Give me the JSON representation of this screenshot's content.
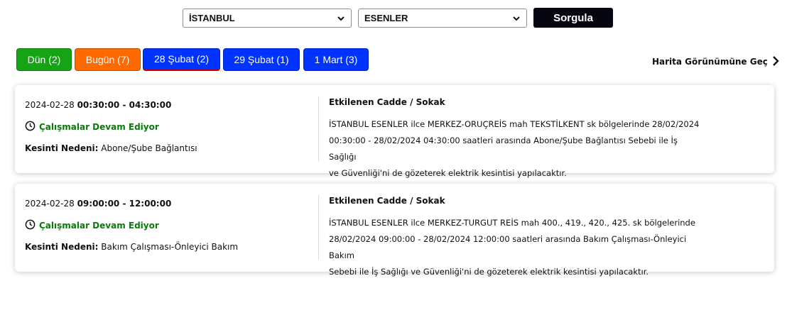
{
  "filters": {
    "city": "İSTANBUL",
    "district": "ESENLER",
    "query_label": "Sorgula"
  },
  "tabs": [
    {
      "label": "Dün (2)",
      "color": "#16a316"
    },
    {
      "label": "Bugün (7)",
      "color": "#ff6a00"
    },
    {
      "label": "28 Şubat (2)",
      "color": "#0033ff",
      "active": true
    },
    {
      "label": "29 Şubat (1)",
      "color": "#0033ff"
    },
    {
      "label": "1 Mart (3)",
      "color": "#0033ff"
    }
  ],
  "map_link": "Harita Görünümüne Geç",
  "outages": [
    {
      "date": "2024-02-28",
      "time_range": "00:30:00 - 04:30:00",
      "status": "Çalışmalar Devam Ediyor",
      "reason_label": "Kesinti Nedeni:",
      "reason": "Abone/Şube Bağlantısı",
      "affected_title": "Etkilenen Cadde / Sokak",
      "affected_lines": [
        "İSTANBUL ESENLER ilce MERKEZ-ORUÇREİS mah TEKSTİLKENT sk bölgelerinde 28/02/2024",
        "00:30:00 - 28/02/2024 04:30:00 saatleri arasında Abone/Şube Bağlantısı Sebebi ile İş Sağlığı",
        "ve Güvenliği'ni de gözeterek elektrik kesintisi yapılacaktır."
      ]
    },
    {
      "date": "2024-02-28",
      "time_range": "09:00:00 - 12:00:00",
      "status": "Çalışmalar Devam Ediyor",
      "reason_label": "Kesinti Nedeni:",
      "reason": "Bakım Çalışması-Önleyici Bakım",
      "affected_title": "Etkilenen Cadde / Sokak",
      "affected_lines": [
        "İSTANBUL ESENLER ilce MERKEZ-TURGUT REİS mah 400., 419., 420., 425. sk bölgelerinde",
        "28/02/2024 09:00:00 - 28/02/2024 12:00:00 saatleri arasında Bakım Çalışması-Önleyici Bakım",
        "Sebebi ile İş Sağlığı ve Güvenliği'ni de gözeterek elektrik kesintisi yapılacaktır."
      ]
    }
  ],
  "icons": {
    "select_chevron": "chevron-down-icon",
    "status": "clock-icon",
    "map_link": "chevron-right-icon"
  }
}
